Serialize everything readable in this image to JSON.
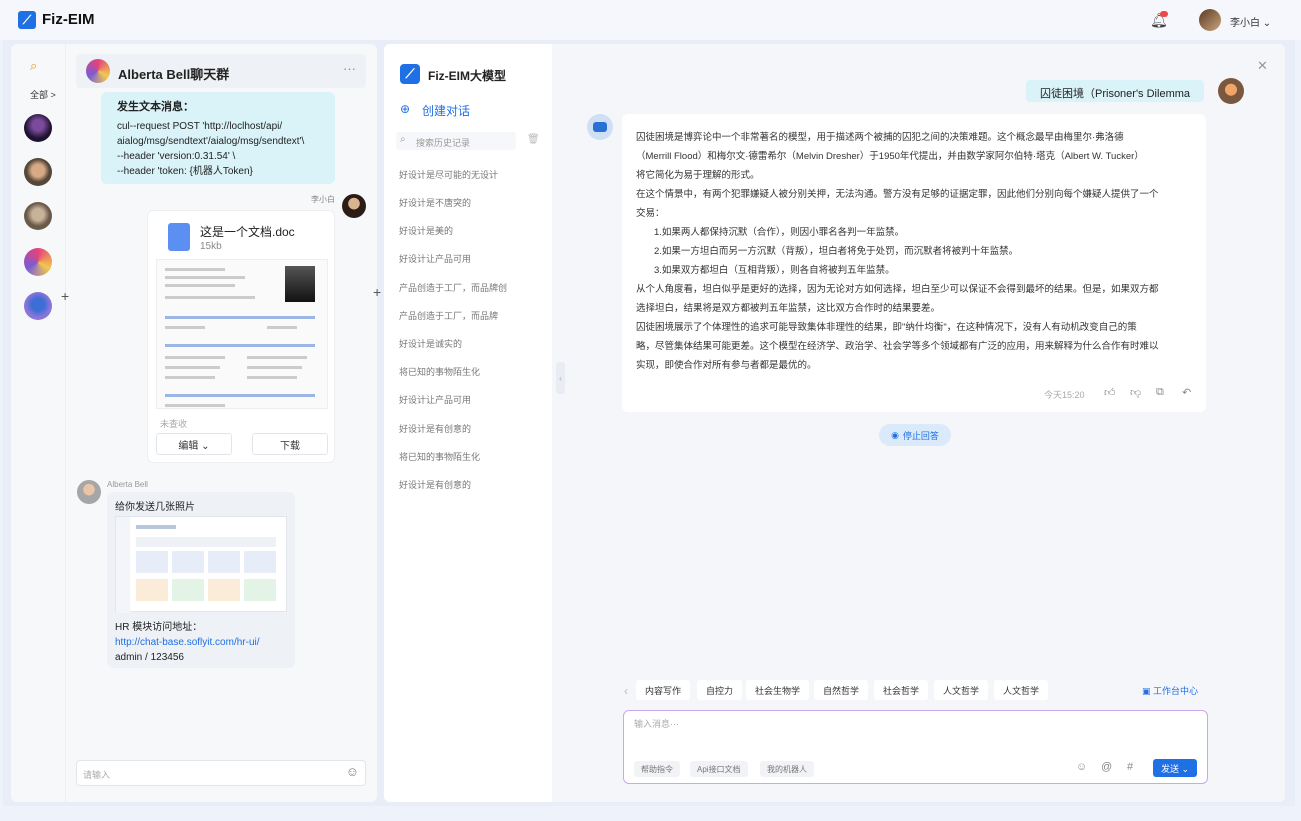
{
  "app": {
    "name": "Fiz-EIM",
    "user_name": "李小白 ⌄"
  },
  "sidebar": {
    "all_label": "全部 >"
  },
  "chat": {
    "title": "Alberta Bell聊天群",
    "code_msg": {
      "heading": "发生文本消息：",
      "lines": [
        "cul--request POST 'http://loclhost/api/",
        "aialog/msg/sendtext'/aialog/msg/sendtext'\\",
        "--header 'version:0.31.54' \\",
        "--header 'token: {机器人Token}"
      ]
    },
    "me_name": "李小白",
    "doc": {
      "name": "这是一个文档.doc",
      "size": "15kb",
      "status": "未查收",
      "edit_label": "编辑 ⌄",
      "download_label": "下载"
    },
    "other_name": "Alberta Bell",
    "image_msg": {
      "caption": "给你发送几张照片",
      "hr_label": "HR 模块访问地址：",
      "link": "http://chat-base.soflyit.com/hr-ui/",
      "creds": "admin / 123456"
    },
    "input_placeholder": "请输入"
  },
  "ai": {
    "title": "Fiz-EIM大模型",
    "new_chat": "创建对话",
    "search_placeholder": "搜索历史记录",
    "history": [
      "好设计是尽可能的无设计",
      "好设计是不唐突的",
      "好设计是美的",
      "好设计让产品可用",
      "产品创造于工厂，而品牌创",
      "产品创造于工厂，而品牌",
      "好设计是诚实的",
      "将已知的事物陌生化",
      "好设计让产品可用",
      "好设计是有创意的",
      "将已知的事物陌生化",
      "好设计是有创意的"
    ],
    "question": "囚徒困境（Prisoner's Dilemma",
    "answer": [
      "囚徒困境是博弈论中一个非常著名的模型，用于描述两个被捕的囚犯之间的决策难题。这个概念最早由梅里尔·弗洛德",
      "（Merrill Flood）和梅尔文·德雷希尔（Melvin Dresher）于1950年代提出，并由数学家阿尔伯特·塔克（Albert W. Tucker）",
      "将它简化为易于理解的形式。",
      "在这个情景中，有两个犯罪嫌疑人被分别关押，无法沟通。警方没有足够的证据定罪，因此他们分别向每个嫌疑人提供了一个",
      "交易：",
      "1.如果两人都保持沉默（合作），则因小罪名各判一年监禁。",
      "2.如果一方坦白而另一方沉默（背叛），坦白者将免于处罚，而沉默者将被判十年监禁。",
      "3.如果双方都坦白（互相背叛），则各自将被判五年监禁。",
      "从个人角度看，坦白似乎是更好的选择，因为无论对方如何选择，坦白至少可以保证不会得到最坏的结果。但是，如果双方都",
      "选择坦白，结果将是双方都被判五年监禁，这比双方合作时的结果要差。",
      "囚徒困境展示了个体理性的追求可能导致集体非理性的结果，即\"纳什均衡\"，在这种情况下，没有人有动机改变自己的策",
      "略，尽管集体结果可能更差。这个模型在经济学、政治学、社会学等多个领域都有广泛的应用，用来解释为什么合作有时难以",
      "实现，即使合作对所有参与者都是最优的。"
    ],
    "answer_time": "今天15:20",
    "stop_label": "停止回答",
    "chips": [
      "内容写作",
      "自控力",
      "社会生物学",
      "自然哲学",
      "社会哲学",
      "人文哲学",
      "人文哲学"
    ],
    "workbench": "工作台中心",
    "compose_placeholder": "输入消息···",
    "tools": [
      "帮助指令",
      "Api接口文档",
      "我的机器人"
    ],
    "send_label": "发送 ⌄"
  }
}
